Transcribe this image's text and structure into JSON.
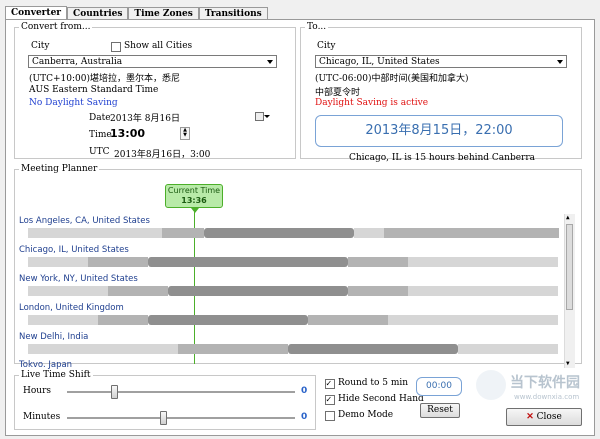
{
  "tabs": [
    "Converter",
    "Countries",
    "Time Zones",
    "Transitions"
  ],
  "convert_from": {
    "legend": "Convert from...",
    "city_label": "City",
    "show_all_label": "Show all Cities",
    "city_value": "Canberra, Australia",
    "tz_line": "(UTC+10:00)堪培拉，墨尔本，悉尼",
    "std_name": "AUS Eastern Standard Time",
    "dst_status": "No Daylight Saving",
    "date_label": "Date",
    "date_value": "2013年 8月16日",
    "time_label": "Time",
    "time_value": "13:00",
    "utc_label": "UTC",
    "utc_value": "2013年8月16日，3:00"
  },
  "to": {
    "legend": "To...",
    "city_label": "City",
    "city_value": "Chicago, IL, United States",
    "tz_line": "(UTC-06:00)中部时间(美国和加拿大)",
    "std_name": "中部夏令时",
    "dst_status": "Daylight Saving is active",
    "result": "2013年8月15日，22:00",
    "diff_text": "Chicago, IL is 15 hours behind Canberra"
  },
  "planner": {
    "legend": "Meeting Planner",
    "current_time_label": "Current Time",
    "current_time_value": "13:36",
    "cities": [
      "Los Angeles, CA, United States",
      "Chicago, IL, United States",
      "New York, NY, United States",
      "London, United Kingdom",
      "New Delhi, India",
      "Tokvo. Japan"
    ]
  },
  "shift": {
    "legend": "Live Time Shift",
    "hours_label": "Hours",
    "hours_value": "0",
    "hours_level": 0.2,
    "minutes_label": "Minutes",
    "minutes_value": "0",
    "minutes_level": 0.42,
    "round_label": "Round to 5 min",
    "hide_second_label": "Hide Second Hand",
    "demo_label": "Demo Mode",
    "clock_value": "00:00",
    "reset_label": "Reset",
    "close_label": "Close"
  },
  "watermark": {
    "text_cn": "当下软件园",
    "url": "www.downxia.com"
  },
  "colors": {
    "accent": "#2a63c9",
    "dst_red": "#e01010",
    "current_time_green": "#4caf2a"
  }
}
